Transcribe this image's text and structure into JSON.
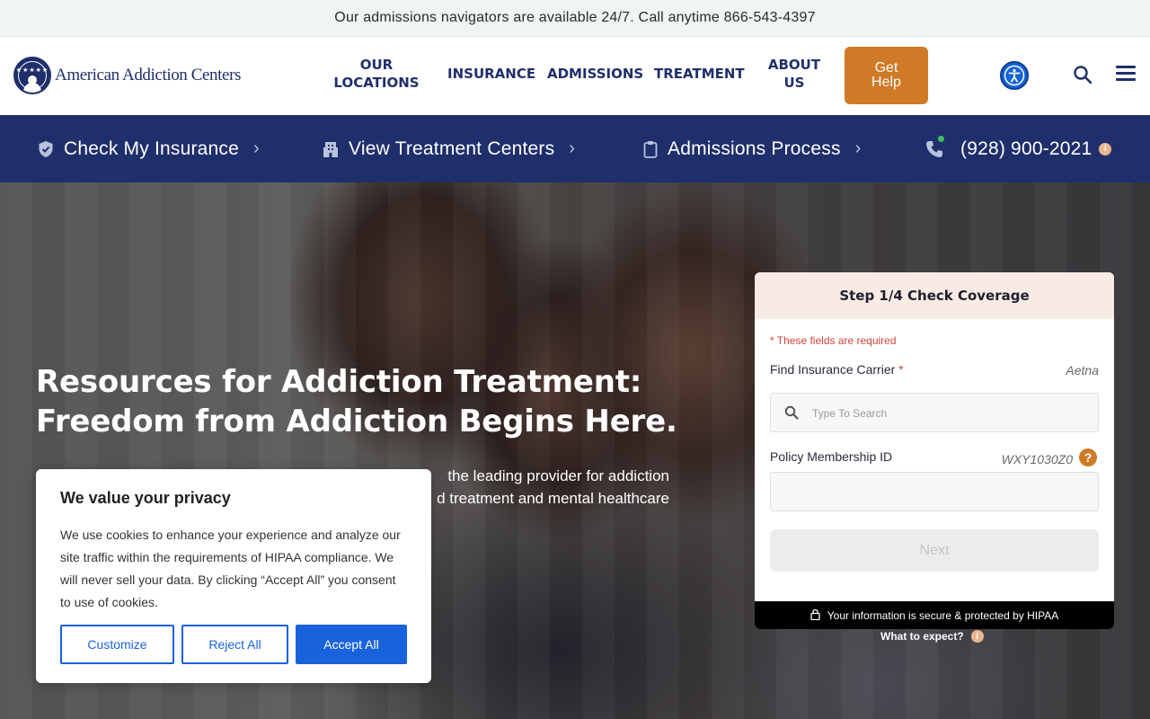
{
  "topbar": {
    "text": "Our admissions navigators are available 24/7. Call anytime 866-543-4397"
  },
  "logo": {
    "text": "American Addiction Centers",
    "stars": "★★★★★"
  },
  "nav": {
    "locations_line1": "OUR",
    "locations_line2": "LOCATIONS",
    "insurance": "INSURANCE",
    "admissions": "ADMISSIONS",
    "treatment": "TREATMENT",
    "about_line1": "ABOUT",
    "about_line2": "US",
    "get_help_line1": "Get",
    "get_help_line2": "Help"
  },
  "subnav": {
    "insurance": "Check My Insurance",
    "centers": "View Treatment Centers",
    "process": "Admissions Process",
    "phone": "(928) 900-2021",
    "chevron": "›",
    "info": "i"
  },
  "hero": {
    "title_line1": "Resources for Addiction Treatment:",
    "title_line2": "Freedom from Addiction Begins Here.",
    "desc_line1": "the leading provider for addiction",
    "desc_line2": "d treatment and mental healthcare"
  },
  "cookie": {
    "title": "We value your privacy",
    "body": "We use cookies to enhance your experience and analyze our site traffic within the requirements of HIPAA compliance. We will never sell your data. By clicking “Accept All” you consent to use of cookies.",
    "customize": "Customize",
    "reject": "Reject All",
    "accept": "Accept All"
  },
  "form": {
    "header": "Step 1/4 Check Coverage",
    "required_note": "* These fields are required",
    "carrier_label": "Find Insurance Carrier",
    "required_mark": "*",
    "carrier_hint": "Aetna",
    "search_placeholder": "Type To Search",
    "policy_label": "Policy Membership ID",
    "policy_hint": "WXY1030Z0",
    "help_mark": "?",
    "next": "Next",
    "secure_text": "Your information is secure & protected by HIPAA",
    "expect_text": "What to expect?",
    "expect_info": "i"
  },
  "colors": {
    "navy": "#1f2f6b",
    "orange": "#cf7a26",
    "cookie_blue": "#1863dc"
  }
}
